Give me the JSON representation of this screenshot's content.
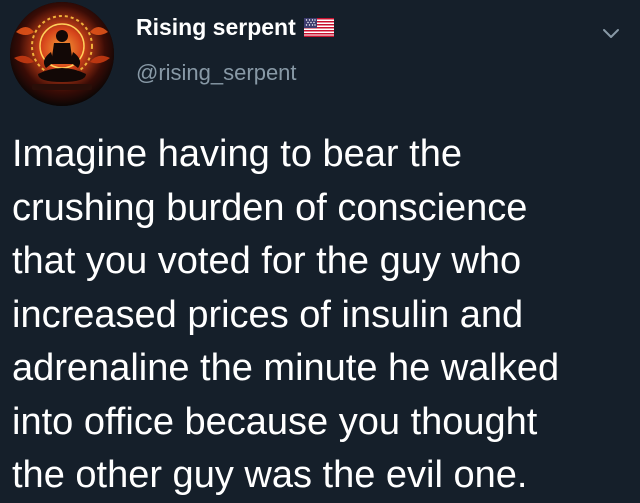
{
  "user": {
    "display_name": "Rising serpent",
    "handle": "@rising_serpent",
    "flag_icon": "us-flag-icon",
    "avatar_icon": "meditating-figure-avatar"
  },
  "menu": {
    "icon": "chevron-down-icon"
  },
  "tweet": {
    "text": "Imagine having to bear the\ncrushing burden of conscience\nthat you voted for the guy who\nincreased prices of insulin and\nadrenaline the minute he walked\ninto office because you thought\nthe other guy was the evil one."
  },
  "colors": {
    "background": "#151f2a",
    "text": "#ffffff",
    "secondary_text": "#8899a6",
    "avatar_accent": "#e2531a"
  }
}
